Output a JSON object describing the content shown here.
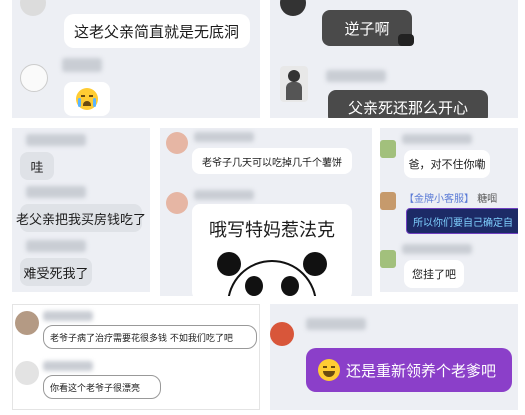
{
  "panel1": {
    "bubble_text": "这老父亲简直就是无底洞"
  },
  "panel2": {
    "top_text": "逆子啊",
    "bottom_text": "父亲死还那么开心"
  },
  "panel3": {
    "messages": [
      "哇",
      "老父亲把我买房钱吃了",
      "难受死我了"
    ]
  },
  "panel4": {
    "message_small": "老爷子几天可以吃掉几千个薯饼",
    "meme_text": "哦写特妈惹法克"
  },
  "panel5": {
    "msg1": "爸，对不住你嘞",
    "tag": "【金牌小客服】",
    "tag_name": "糖啯",
    "highlight_msg": "所以你们要自己确定自",
    "msg3": "您挂了吧"
  },
  "panel6": {
    "msg1": "老爷子病了治疗需要花很多钱  不如我们吃了吧",
    "msg2": "你看这个老爷子很漂亮"
  },
  "panel7": {
    "bubble_text": "还是重新领养个老爹吧"
  },
  "colors": {
    "panel_bg": "#edeff4",
    "dark_bubble": "#4a4a4a",
    "purple_bubble": "#8b3fc9",
    "highlight_bg": "#1c2a66",
    "highlight_text": "#7fd0ff"
  }
}
